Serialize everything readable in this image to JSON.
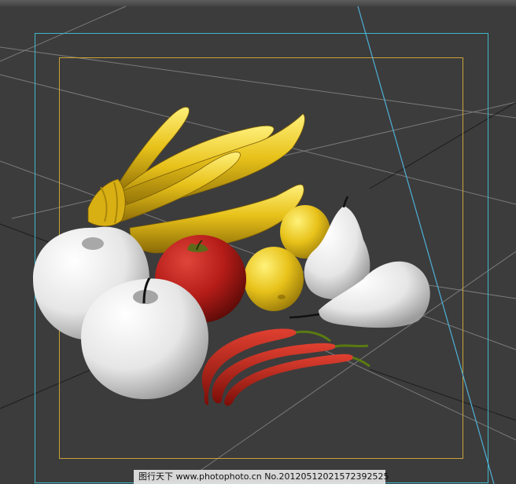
{
  "viewport": {
    "background": "#3c3c3c",
    "grid_color": "#9a9a9a",
    "dark_grid_color": "#1a1a1a",
    "safe_frame_outer_color": "#3fb8c9",
    "safe_frame_inner_color": "#c9a23a",
    "camera_line_color": "#4fb0d8"
  },
  "objects": [
    {
      "name": "banana-bunch",
      "color": "#e8c21a"
    },
    {
      "name": "apple-white-left",
      "color": "#f2f2f2"
    },
    {
      "name": "apple-white-front",
      "color": "#f2f2f2"
    },
    {
      "name": "apple-red",
      "color": "#b41c18"
    },
    {
      "name": "lemon",
      "color": "#e8c21a"
    },
    {
      "name": "pear-upright",
      "color": "#f2f2f2"
    },
    {
      "name": "pear-lying",
      "color": "#f2f2f2"
    },
    {
      "name": "chili-peppers",
      "color": "#b8201a"
    }
  ],
  "watermark": {
    "text": "图行天下 www.photophoto.cn No.20120512021572392525"
  }
}
